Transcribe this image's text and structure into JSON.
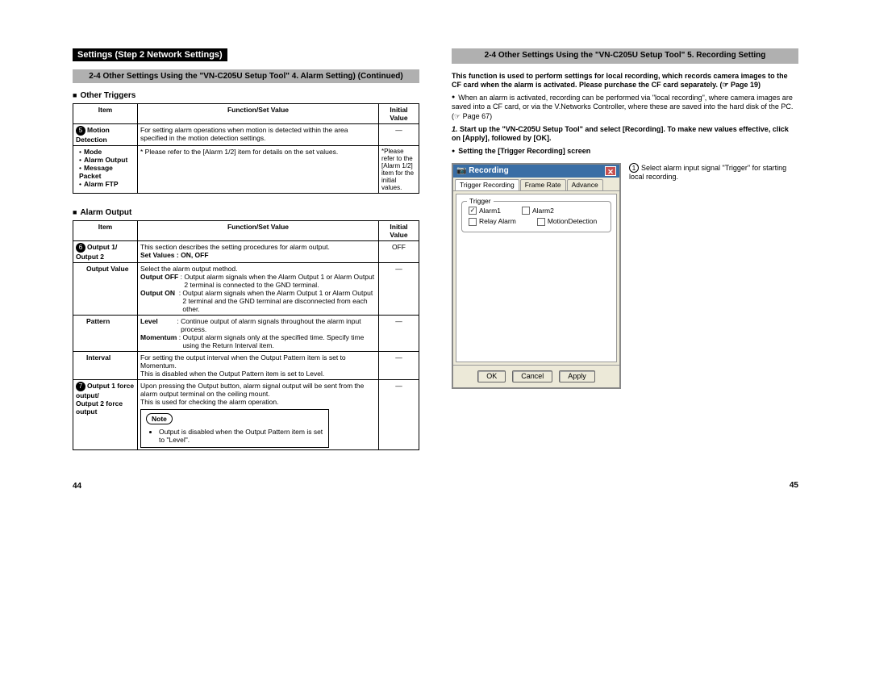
{
  "left": {
    "header": "Settings (Step 2 Network Settings)",
    "graybar": "2-4 Other Settings Using the \"VN-C205U Setup Tool\" 4. Alarm Setting) (Continued)",
    "section1_title": "Other Triggers",
    "table1": {
      "headers": [
        "Item",
        "Function/Set Value",
        "Initial Value"
      ],
      "rows": [
        {
          "num": "5",
          "item": "Motion Detection",
          "func": "For setting alarm operations when motion is detected within the area specified in the motion detection settings.",
          "init": "—"
        },
        {
          "num": "",
          "item_bullets": [
            "Mode",
            "Alarm Output",
            "Message Packet",
            "Alarm FTP"
          ],
          "func": "* Please refer to the [Alarm 1/2] item for details on the set values.",
          "init": "*Please refer to the [Alarm 1/2] item for the initial values."
        }
      ]
    },
    "section2_title": "Alarm Output",
    "table2": {
      "headers": [
        "Item",
        "Function/Set Value",
        "Initial Value"
      ],
      "rows": [
        {
          "num": "6",
          "item": "Output 1/\nOutput 2",
          "func": "This section describes the setting procedures for alarm output.",
          "func_extra": "Set Values  : ON, OFF",
          "init": "OFF"
        },
        {
          "item": "Output Value",
          "func_lines": [
            "Select the alarm output method.",
            "Output OFF : Output alarm signals when the Alarm Output 1 or Alarm Output 2 terminal is connected to the GND terminal.",
            "Output ON  : Output alarm signals when the Alarm Output 1 or Alarm Output 2 terminal and the GND terminal are disconnected from each other."
          ],
          "init": "—"
        },
        {
          "item": "Pattern",
          "func_lines": [
            "Level          : Continue output of alarm signals throughout the alarm input process.",
            "Momentum : Output alarm signals only at the specified time. Specify time using the Return Interval item."
          ],
          "init": "—"
        },
        {
          "item": "Interval",
          "func": "For setting the output interval when the Output Pattern item is set to Momentum.\nThis is disabled when the Output Pattern item is set to Level.",
          "init": "—"
        },
        {
          "num": "7",
          "item": "Output 1 force output/\nOutput 2 force output",
          "func": "Upon pressing the Output button, alarm signal output will be sent from the alarm output terminal on the ceiling mount.\nThis is used for checking the alarm operation.",
          "note_label": "Note",
          "note": "Output is disabled when the Output Pattern item is set to \"Level\".",
          "init": "—"
        }
      ]
    },
    "pagenum": "44"
  },
  "right": {
    "graybar": "2-4 Other Settings Using the \"VN-C205U Setup Tool\" 5. Recording Setting",
    "intro_bold": "This function is used to perform settings for local recording, which records camera images to the CF card when the alarm is activated. Please purchase the CF card separately. (☞ Page 19)",
    "intro_bullet": "When an alarm is activated, recording can be performed via \"local recording\", where camera images are saved into a CF card, or via the V.Networks Controller, where these are saved into the hard disk of the PC. (☞ Page 67)",
    "step1_num": "1.",
    "step1": "Start up the \"VN-C205U Setup Tool\" and select [Recording]. To make new values effective, click on [Apply], followed by [OK].",
    "setting_head": "Setting the [Trigger Recording] screen",
    "dialog": {
      "title": "Recording",
      "tabs": [
        "Trigger Recording",
        "Frame Rate",
        "Advance"
      ],
      "legend": "Trigger",
      "checks": [
        {
          "label": "Alarm1",
          "checked": true
        },
        {
          "label": "Alarm2",
          "checked": false
        },
        {
          "label": "Relay Alarm",
          "checked": false
        },
        {
          "label": "MotionDetection",
          "checked": false
        }
      ],
      "buttons": [
        "OK",
        "Cancel",
        "Apply"
      ]
    },
    "annot_num": "1",
    "annot": "Select alarm input signal \"Trigger\" for starting local recording.",
    "pagenum": "45"
  }
}
